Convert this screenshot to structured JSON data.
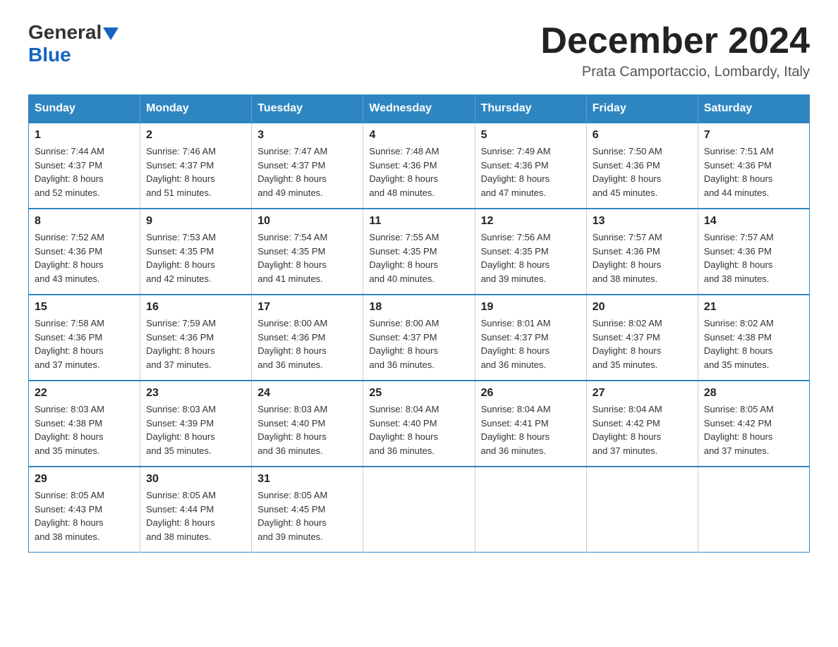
{
  "logo": {
    "general": "General",
    "blue": "Blue",
    "triangle": "▼"
  },
  "title": "December 2024",
  "subtitle": "Prata Camportaccio, Lombardy, Italy",
  "days_of_week": [
    "Sunday",
    "Monday",
    "Tuesday",
    "Wednesday",
    "Thursday",
    "Friday",
    "Saturday"
  ],
  "weeks": [
    [
      {
        "day": "1",
        "info": "Sunrise: 7:44 AM\nSunset: 4:37 PM\nDaylight: 8 hours\nand 52 minutes."
      },
      {
        "day": "2",
        "info": "Sunrise: 7:46 AM\nSunset: 4:37 PM\nDaylight: 8 hours\nand 51 minutes."
      },
      {
        "day": "3",
        "info": "Sunrise: 7:47 AM\nSunset: 4:37 PM\nDaylight: 8 hours\nand 49 minutes."
      },
      {
        "day": "4",
        "info": "Sunrise: 7:48 AM\nSunset: 4:36 PM\nDaylight: 8 hours\nand 48 minutes."
      },
      {
        "day": "5",
        "info": "Sunrise: 7:49 AM\nSunset: 4:36 PM\nDaylight: 8 hours\nand 47 minutes."
      },
      {
        "day": "6",
        "info": "Sunrise: 7:50 AM\nSunset: 4:36 PM\nDaylight: 8 hours\nand 45 minutes."
      },
      {
        "day": "7",
        "info": "Sunrise: 7:51 AM\nSunset: 4:36 PM\nDaylight: 8 hours\nand 44 minutes."
      }
    ],
    [
      {
        "day": "8",
        "info": "Sunrise: 7:52 AM\nSunset: 4:36 PM\nDaylight: 8 hours\nand 43 minutes."
      },
      {
        "day": "9",
        "info": "Sunrise: 7:53 AM\nSunset: 4:35 PM\nDaylight: 8 hours\nand 42 minutes."
      },
      {
        "day": "10",
        "info": "Sunrise: 7:54 AM\nSunset: 4:35 PM\nDaylight: 8 hours\nand 41 minutes."
      },
      {
        "day": "11",
        "info": "Sunrise: 7:55 AM\nSunset: 4:35 PM\nDaylight: 8 hours\nand 40 minutes."
      },
      {
        "day": "12",
        "info": "Sunrise: 7:56 AM\nSunset: 4:35 PM\nDaylight: 8 hours\nand 39 minutes."
      },
      {
        "day": "13",
        "info": "Sunrise: 7:57 AM\nSunset: 4:36 PM\nDaylight: 8 hours\nand 38 minutes."
      },
      {
        "day": "14",
        "info": "Sunrise: 7:57 AM\nSunset: 4:36 PM\nDaylight: 8 hours\nand 38 minutes."
      }
    ],
    [
      {
        "day": "15",
        "info": "Sunrise: 7:58 AM\nSunset: 4:36 PM\nDaylight: 8 hours\nand 37 minutes."
      },
      {
        "day": "16",
        "info": "Sunrise: 7:59 AM\nSunset: 4:36 PM\nDaylight: 8 hours\nand 37 minutes."
      },
      {
        "day": "17",
        "info": "Sunrise: 8:00 AM\nSunset: 4:36 PM\nDaylight: 8 hours\nand 36 minutes."
      },
      {
        "day": "18",
        "info": "Sunrise: 8:00 AM\nSunset: 4:37 PM\nDaylight: 8 hours\nand 36 minutes."
      },
      {
        "day": "19",
        "info": "Sunrise: 8:01 AM\nSunset: 4:37 PM\nDaylight: 8 hours\nand 36 minutes."
      },
      {
        "day": "20",
        "info": "Sunrise: 8:02 AM\nSunset: 4:37 PM\nDaylight: 8 hours\nand 35 minutes."
      },
      {
        "day": "21",
        "info": "Sunrise: 8:02 AM\nSunset: 4:38 PM\nDaylight: 8 hours\nand 35 minutes."
      }
    ],
    [
      {
        "day": "22",
        "info": "Sunrise: 8:03 AM\nSunset: 4:38 PM\nDaylight: 8 hours\nand 35 minutes."
      },
      {
        "day": "23",
        "info": "Sunrise: 8:03 AM\nSunset: 4:39 PM\nDaylight: 8 hours\nand 35 minutes."
      },
      {
        "day": "24",
        "info": "Sunrise: 8:03 AM\nSunset: 4:40 PM\nDaylight: 8 hours\nand 36 minutes."
      },
      {
        "day": "25",
        "info": "Sunrise: 8:04 AM\nSunset: 4:40 PM\nDaylight: 8 hours\nand 36 minutes."
      },
      {
        "day": "26",
        "info": "Sunrise: 8:04 AM\nSunset: 4:41 PM\nDaylight: 8 hours\nand 36 minutes."
      },
      {
        "day": "27",
        "info": "Sunrise: 8:04 AM\nSunset: 4:42 PM\nDaylight: 8 hours\nand 37 minutes."
      },
      {
        "day": "28",
        "info": "Sunrise: 8:05 AM\nSunset: 4:42 PM\nDaylight: 8 hours\nand 37 minutes."
      }
    ],
    [
      {
        "day": "29",
        "info": "Sunrise: 8:05 AM\nSunset: 4:43 PM\nDaylight: 8 hours\nand 38 minutes."
      },
      {
        "day": "30",
        "info": "Sunrise: 8:05 AM\nSunset: 4:44 PM\nDaylight: 8 hours\nand 38 minutes."
      },
      {
        "day": "31",
        "info": "Sunrise: 8:05 AM\nSunset: 4:45 PM\nDaylight: 8 hours\nand 39 minutes."
      },
      null,
      null,
      null,
      null
    ]
  ]
}
